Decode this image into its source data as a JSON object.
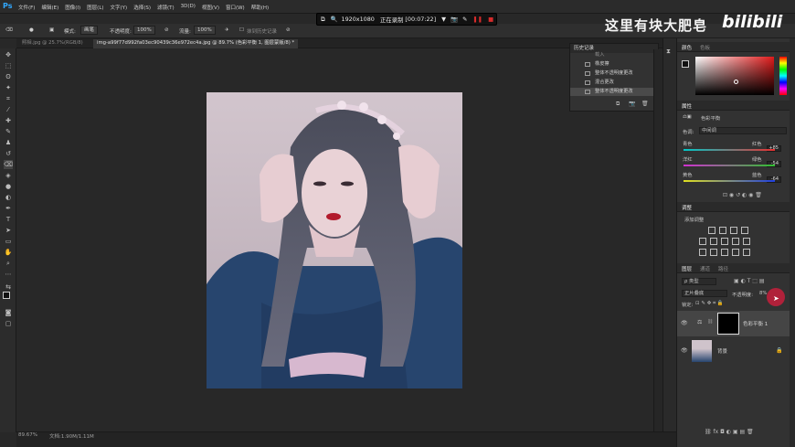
{
  "app": {
    "logo": "Ps"
  },
  "menu": [
    "文件(F)",
    "编辑(E)",
    "图像(I)",
    "图层(L)",
    "文字(Y)",
    "选择(S)",
    "滤镜(T)",
    "3D(D)",
    "视图(V)",
    "窗口(W)",
    "帮助(H)"
  ],
  "recording": {
    "resolution": "1920x1080",
    "status": "正在录制",
    "elapsed": "[00:07:22]"
  },
  "watermark": {
    "text": "这里有块大肥皂",
    "brand": "bilibili"
  },
  "options_bar": {
    "mode_label": "模式:",
    "mode_value": "画笔",
    "opacity_label": "不透明度:",
    "opacity_value": "100%",
    "flow_label": "流量:",
    "flow_value": "100%",
    "history_erase": "抹到历史记录"
  },
  "tabs": [
    {
      "label": "照相.jpg @ 25.7%(RGB/8)",
      "active": false
    },
    {
      "label": "img-a99f77d992fa03ec90439c36e972ec4a.jpg @ 89.7% (色彩平衡 1, 图层蒙版/8) *",
      "active": true
    }
  ],
  "history_panel": {
    "title": "历史记录",
    "items": [
      {
        "label": "载入",
        "selected": false
      },
      {
        "label": "橡皮擦",
        "selected": false
      },
      {
        "label": "整体不透明度更改",
        "selected": false
      },
      {
        "label": "混合更改",
        "selected": false
      },
      {
        "label": "整体不透明度更改",
        "selected": true
      }
    ]
  },
  "color_panel": {
    "tab_color": "颜色",
    "tab_swatches": "色板"
  },
  "properties_panel": {
    "title": "属性",
    "adjustment_name": "色彩平衡",
    "tone_label": "色调:",
    "tone_value": "中间调",
    "sliders": [
      {
        "left": "青色",
        "right": "红色",
        "value": "+85"
      },
      {
        "left": "洋红",
        "right": "绿色",
        "value": "-54"
      },
      {
        "left": "黄色",
        "right": "蓝色",
        "value": "-64"
      }
    ]
  },
  "adjustments_panel": {
    "title": "调整",
    "add_label": "添加调整"
  },
  "layers_panel": {
    "tabs": [
      "图层",
      "通道",
      "路径"
    ],
    "kind_label": "ρ 类型",
    "blend_mode": "正片叠底",
    "opacity_label": "不透明度:",
    "opacity_value": "8%",
    "lock_label": "锁定:",
    "layers": [
      {
        "name": "色彩平衡 1"
      },
      {
        "name": "背景"
      }
    ]
  },
  "status_bar": {
    "zoom": "89.67%",
    "doc": "文档:1.90M/1.11M"
  },
  "colors": {
    "accent": "#31a8ff",
    "record_red": "#d62b2b",
    "cursor_red": "#b0213a",
    "photo_bg": "#cfc3cb",
    "sweater": "#27456e"
  }
}
